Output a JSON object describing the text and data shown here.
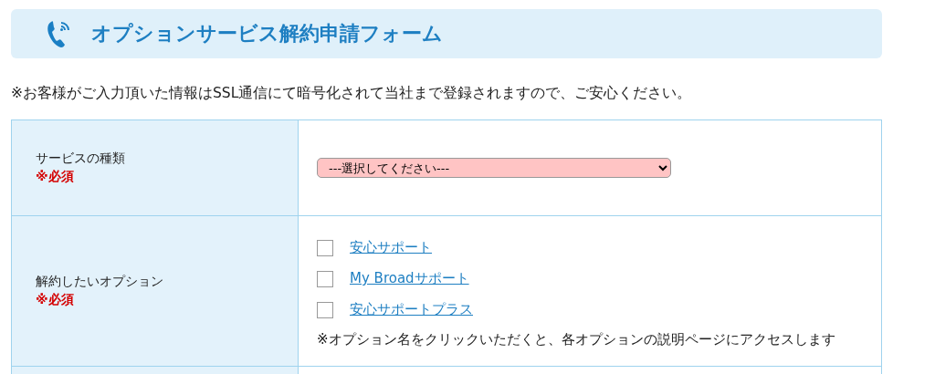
{
  "header": {
    "title": "オプションサービス解約申請フォーム"
  },
  "notice": "※お客様がご入力頂いた情報はSSL通信にて暗号化されて当社まで登録されますので、ご安心ください。",
  "form_rows": [
    {
      "kind": "select",
      "label": "サービスの種類",
      "required": "※必須",
      "value": "---選択してください---",
      "invalid": true
    },
    {
      "kind": "checkboxes",
      "label": "解約したいオプション",
      "required": "※必須",
      "options": [
        {
          "label": "安心サポート",
          "checked": false
        },
        {
          "label": "My Broadサポート",
          "checked": false
        },
        {
          "label": "安心サポートプラス",
          "checked": false
        }
      ],
      "note": "※オプション名をクリックいただくと、各オプションの説明ページにアクセスします"
    },
    {
      "kind": "empty"
    }
  ]
}
